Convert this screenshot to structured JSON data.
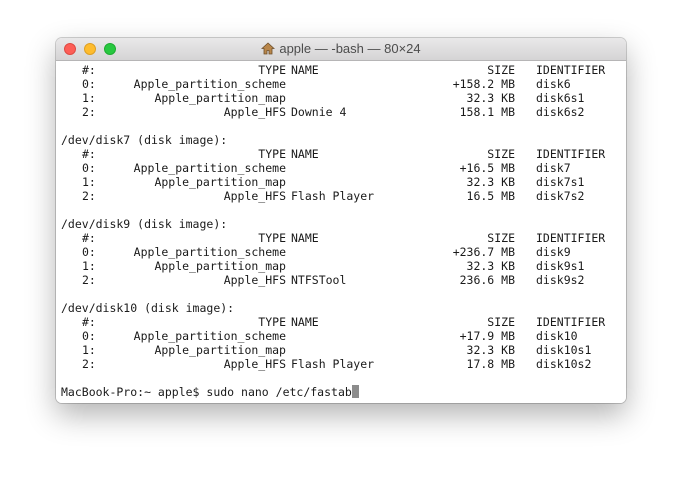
{
  "window": {
    "title": "apple — -bash — 80×24"
  },
  "terminal": {
    "header": {
      "idx": "#:",
      "type": "TYPE",
      "name": "NAME",
      "size": "SIZE",
      "ident": "IDENTIFIER"
    },
    "top_rows": [
      {
        "idx": "0:",
        "type": "Apple_partition_scheme",
        "name": "",
        "size": "+158.2 MB",
        "ident": "disk6"
      },
      {
        "idx": "1:",
        "type": "Apple_partition_map",
        "name": "",
        "size": "32.3 KB",
        "ident": "disk6s1"
      },
      {
        "idx": "2:",
        "type": "Apple_HFS",
        "name": "Downie 4",
        "size": "158.1 MB",
        "ident": "disk6s2"
      }
    ],
    "disks": [
      {
        "label": "/dev/disk7 (disk image):",
        "rows": [
          {
            "idx": "0:",
            "type": "Apple_partition_scheme",
            "name": "",
            "size": "+16.5 MB",
            "ident": "disk7"
          },
          {
            "idx": "1:",
            "type": "Apple_partition_map",
            "name": "",
            "size": "32.3 KB",
            "ident": "disk7s1"
          },
          {
            "idx": "2:",
            "type": "Apple_HFS",
            "name": "Flash Player",
            "size": "16.5 MB",
            "ident": "disk7s2"
          }
        ]
      },
      {
        "label": "/dev/disk9 (disk image):",
        "rows": [
          {
            "idx": "0:",
            "type": "Apple_partition_scheme",
            "name": "",
            "size": "+236.7 MB",
            "ident": "disk9"
          },
          {
            "idx": "1:",
            "type": "Apple_partition_map",
            "name": "",
            "size": "32.3 KB",
            "ident": "disk9s1"
          },
          {
            "idx": "2:",
            "type": "Apple_HFS",
            "name": "NTFSTool",
            "size": "236.6 MB",
            "ident": "disk9s2"
          }
        ]
      },
      {
        "label": "/dev/disk10 (disk image):",
        "rows": [
          {
            "idx": "0:",
            "type": "Apple_partition_scheme",
            "name": "",
            "size": "+17.9 MB",
            "ident": "disk10"
          },
          {
            "idx": "1:",
            "type": "Apple_partition_map",
            "name": "",
            "size": "32.3 KB",
            "ident": "disk10s1"
          },
          {
            "idx": "2:",
            "type": "Apple_HFS",
            "name": "Flash Player",
            "size": "17.8 MB",
            "ident": "disk10s2"
          }
        ]
      }
    ],
    "prompt": "MacBook-Pro:~ apple$ ",
    "command": "sudo nano /etc/fastab"
  },
  "icons": {
    "close": "close-button-red",
    "minimize": "minimize-button-yellow",
    "maximize": "zoom-button-green",
    "title": "home-icon"
  },
  "colors": {
    "close": "#fd5e57",
    "minimize": "#febc2e",
    "maximize": "#28c840",
    "text": "#1a1a1a",
    "cursor": "#8c8c8c"
  }
}
